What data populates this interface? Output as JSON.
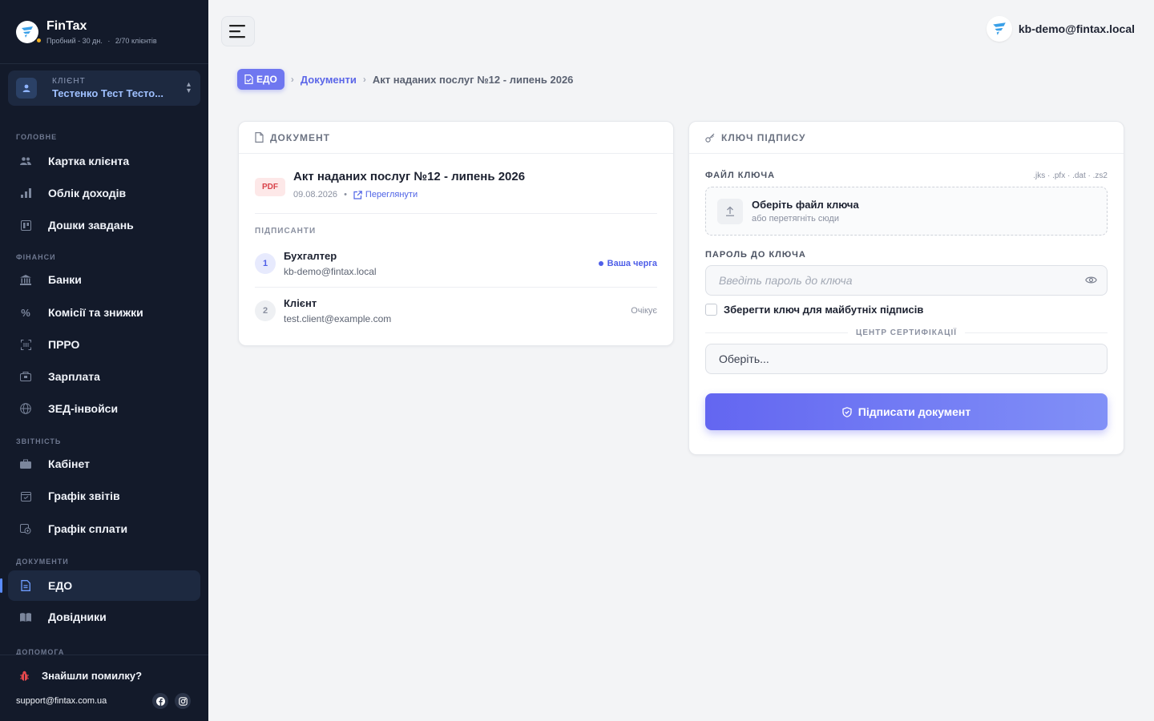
{
  "brand": {
    "name": "FinTax",
    "trial": "Пробний - 30 дн.",
    "clients": "2/70 клієнтів"
  },
  "client": {
    "label": "КЛІЄНТ",
    "name": "Тестенко Тест Тесто..."
  },
  "nav": {
    "main_label": "Головне",
    "main": [
      {
        "label": "Картка клієнта",
        "icon": "users-icon"
      },
      {
        "label": "Облік доходів",
        "icon": "bar-chart-icon"
      },
      {
        "label": "Дошки завдань",
        "icon": "board-icon"
      }
    ],
    "finance_label": "Фінанси",
    "finance": [
      {
        "label": "Банки",
        "icon": "bank-icon"
      },
      {
        "label": "Комісії та знижки",
        "icon": "percent-icon"
      },
      {
        "label": "ПРРО",
        "icon": "scan-icon"
      },
      {
        "label": "Зарплата",
        "icon": "wallet-icon"
      },
      {
        "label": "ЗЕД-інвойси",
        "icon": "globe-icon"
      }
    ],
    "reports_label": "Звітність",
    "reports": [
      {
        "label": "Кабінет",
        "icon": "briefcase-icon"
      },
      {
        "label": "Графік звітів",
        "icon": "calendar-icon"
      },
      {
        "label": "Графік сплати",
        "icon": "payment-icon"
      }
    ],
    "docs_label": "Документи",
    "docs": [
      {
        "label": "ЕДО",
        "icon": "document-icon"
      },
      {
        "label": "Довідники",
        "icon": "book-icon"
      }
    ],
    "help_label": "Допомога"
  },
  "footer": {
    "bug": "Знайшли помилку?",
    "support": "support@fintax.com.ua"
  },
  "user": {
    "email": "kb-demo@fintax.local"
  },
  "breadcrumb": {
    "edo": "ЕДО",
    "docs": "Документи",
    "current": "Акт наданих послуг №12 - липень 2026"
  },
  "document": {
    "header": "ДОКУМЕНТ",
    "badge": "PDF",
    "title": "Акт наданих послуг №12 - липень 2026",
    "date": "09.08.2026",
    "view": "Переглянути",
    "signers_label": "ПІДПИСАНТИ",
    "signers": [
      {
        "num": "1",
        "name": "Бухгалтер",
        "email": "kb-demo@fintax.local",
        "status": "Ваша черга"
      },
      {
        "num": "2",
        "name": "Клієнт",
        "email": "test.client@example.com",
        "status": "Очікує"
      }
    ]
  },
  "key": {
    "header": "КЛЮЧ ПІДПИСУ",
    "file_label": "ФАЙЛ КЛЮЧА",
    "extensions": ".jks · .pfx · .dat · .zs2",
    "drop_title": "Оберіть файл ключа",
    "drop_sub": "або перетягніть сюди",
    "password_label": "ПАРОЛЬ ДО КЛЮЧА",
    "password_placeholder": "Введіть пароль до ключа",
    "save_label": "Зберегти ключ для майбутніх підписів",
    "center_label": "ЦЕНТР СЕРТИФІКАЦІЇ",
    "center_value": "Оберіть...",
    "sign_button": "Підписати документ"
  },
  "colors": {
    "accent": "#6366f1",
    "sidebar": "#131a2a",
    "danger": "#d9434a"
  }
}
